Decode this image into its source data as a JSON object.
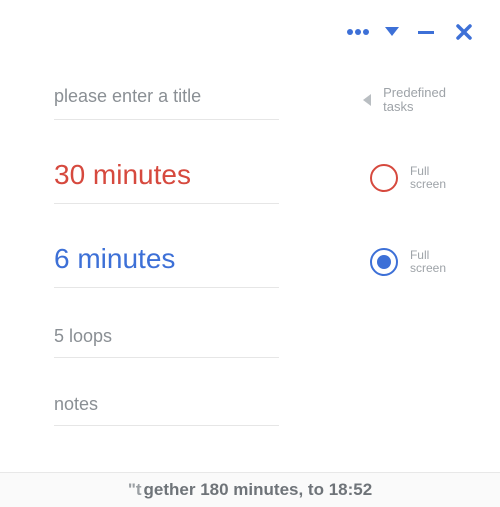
{
  "colors": {
    "accent_red": "#d6493e",
    "accent_blue": "#3d70d7",
    "muted": "#8a8f94"
  },
  "titlebar": {
    "more_icon": "more-horizontal",
    "dropdown_icon": "caret-down",
    "minimize_icon": "minimize",
    "close_icon": "close"
  },
  "form": {
    "title": {
      "value": "",
      "placeholder": "please enter a title"
    },
    "predefined": {
      "line1": "Predefined",
      "line2": "tasks"
    },
    "work": {
      "duration_text": "30 minutes",
      "fullscreen": {
        "line1": "Full",
        "line2": "screen",
        "selected": false
      }
    },
    "break": {
      "duration_text": "6 minutes",
      "fullscreen": {
        "line1": "Full",
        "line2": "screen",
        "selected": true
      }
    },
    "loops": {
      "text": "5 loops"
    },
    "notes": {
      "value": "",
      "placeholder": "notes"
    }
  },
  "footer": {
    "cut_prefix": "\"t",
    "text": "gether 180 minutes, to 18:52"
  }
}
